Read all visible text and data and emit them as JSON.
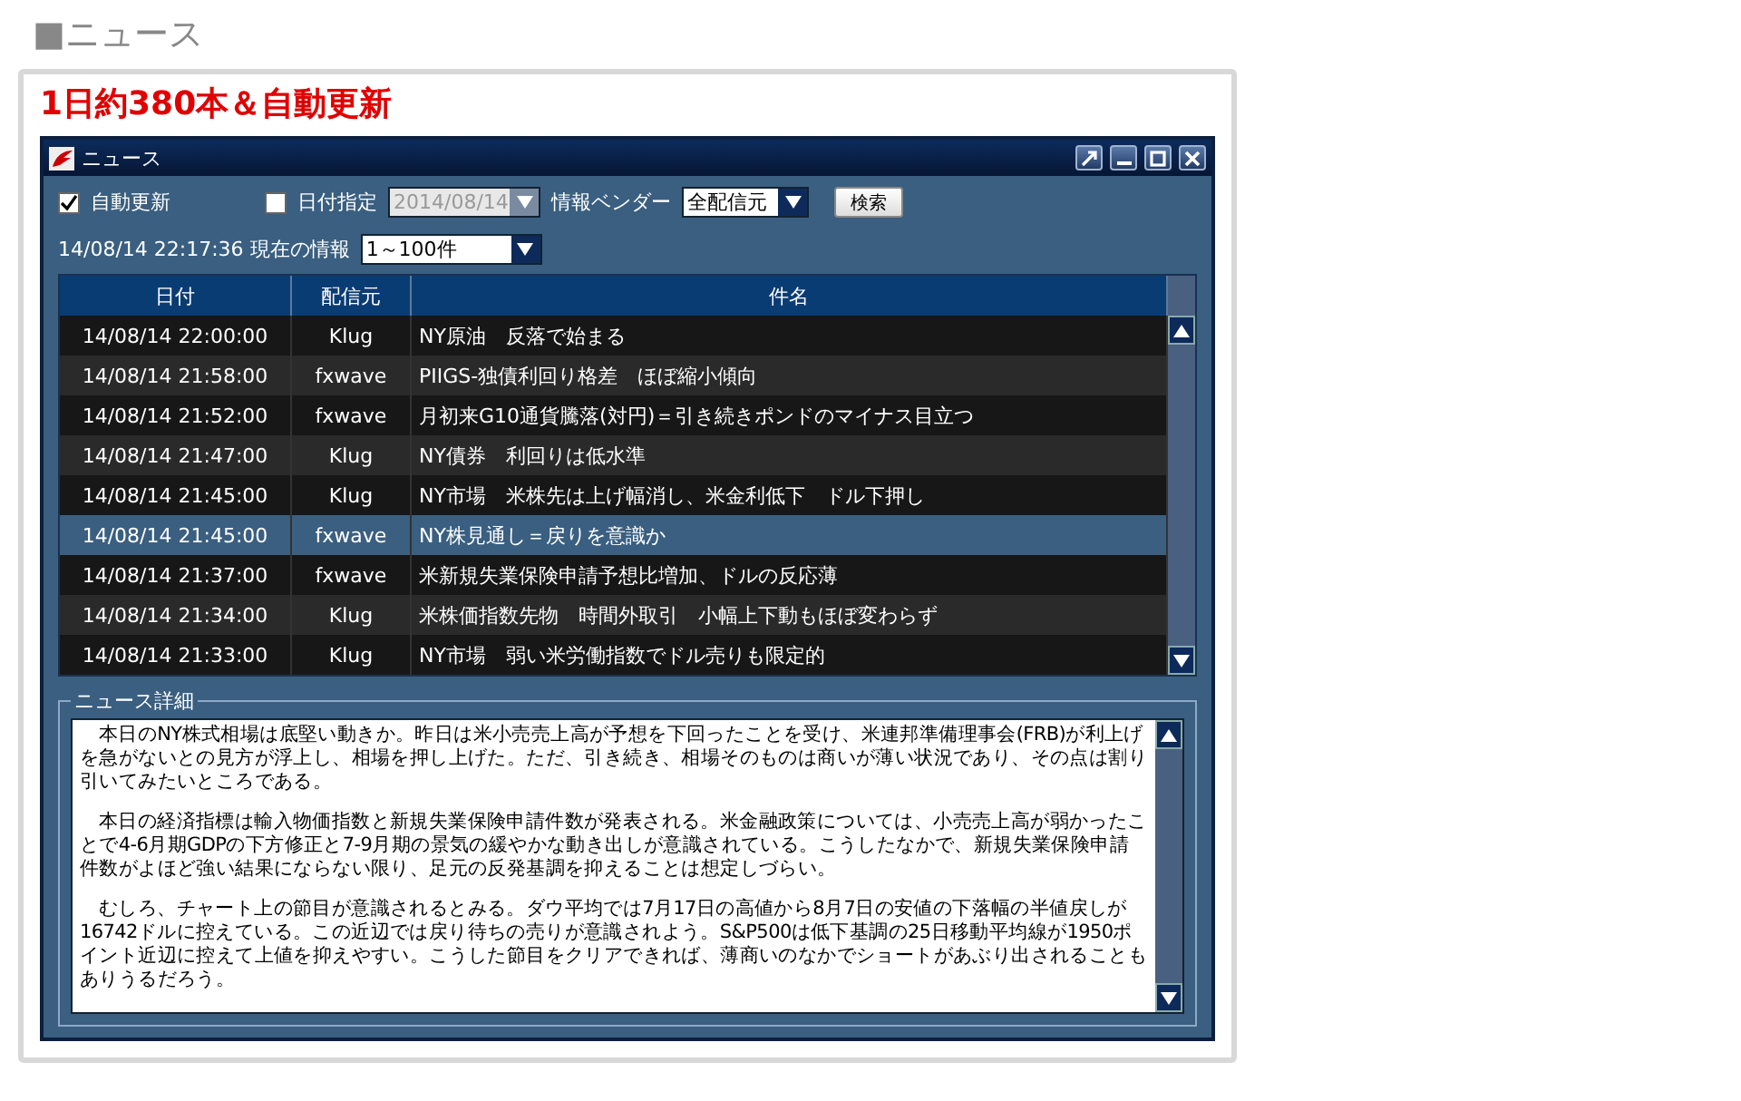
{
  "page_title": "■ニュース",
  "headline": "1日約380本＆自動更新",
  "window": {
    "title": "ニュース"
  },
  "toolbar": {
    "auto_update": {
      "label": "自動更新",
      "checked": true
    },
    "date_filter": {
      "label": "日付指定",
      "checked": false,
      "value": "2014/08/14"
    },
    "vendor": {
      "label": "情報ベンダー",
      "value": "全配信元"
    },
    "search_button": "検索",
    "current_info": "14/08/14 22:17:36 現在の情報",
    "range": "1～100件"
  },
  "table": {
    "columns": [
      "日付",
      "配信元",
      "件名"
    ],
    "rows": [
      {
        "date": "14/08/14 22:00:00",
        "source": "Klug",
        "subject": "NY原油　反落で始まる",
        "selected": false
      },
      {
        "date": "14/08/14 21:58:00",
        "source": "fxwave",
        "subject": "PIIGS-独債利回り格差　ほぼ縮小傾向",
        "selected": false
      },
      {
        "date": "14/08/14 21:52:00",
        "source": "fxwave",
        "subject": "月初来G10通貨騰落(対円)＝引き続きポンドのマイナス目立つ",
        "selected": false
      },
      {
        "date": "14/08/14 21:47:00",
        "source": "Klug",
        "subject": "NY債券　利回りは低水準",
        "selected": false
      },
      {
        "date": "14/08/14 21:45:00",
        "source": "Klug",
        "subject": "NY市場　米株先は上げ幅消し、米金利低下　ドル下押し",
        "selected": false
      },
      {
        "date": "14/08/14 21:45:00",
        "source": "fxwave",
        "subject": "NY株見通し＝戻りを意識か",
        "selected": true
      },
      {
        "date": "14/08/14 21:37:00",
        "source": "fxwave",
        "subject": "米新規失業保険申請予想比増加、ドルの反応薄",
        "selected": false
      },
      {
        "date": "14/08/14 21:34:00",
        "source": "Klug",
        "subject": "米株価指数先物　時間外取引　小幅上下動もほぼ変わらず",
        "selected": false
      },
      {
        "date": "14/08/14 21:33:00",
        "source": "Klug",
        "subject": "NY市場　弱い米労働指数でドル売りも限定的",
        "selected": false
      }
    ]
  },
  "detail": {
    "title": "ニュース詳細",
    "paragraphs": [
      "本日のNY株式相場は底堅い動きか。昨日は米小売売上高が予想を下回ったことを受け、米連邦準備理事会(FRB)が利上げを急がないとの見方が浮上し、相場を押し上げた。ただ、引き続き、相場そのものは商いが薄い状況であり、その点は割り引いてみたいところである。",
      "本日の経済指標は輸入物価指数と新規失業保険申請件数が発表される。米金融政策については、小売売上高が弱かったことで4-6月期GDPの下方修正と7-9月期の景気の緩やかな動き出しが意識されている。こうしたなかで、新規失業保険申請件数がよほど強い結果にならない限り、足元の反発基調を抑えることは想定しづらい。",
      "むしろ、チャート上の節目が意識されるとみる。ダウ平均では7月17日の高値から8月7日の安値の下落幅の半値戻しが16742ドルに控えている。この近辺では戻り待ちの売りが意識されよう。S&P500は低下基調の25日移動平均線が1950ポイント近辺に控えて上値を抑えやすい。こうした節目をクリアできれば、薄商いのなかでショートがあぶり出されることもありうるだろう。"
    ]
  }
}
